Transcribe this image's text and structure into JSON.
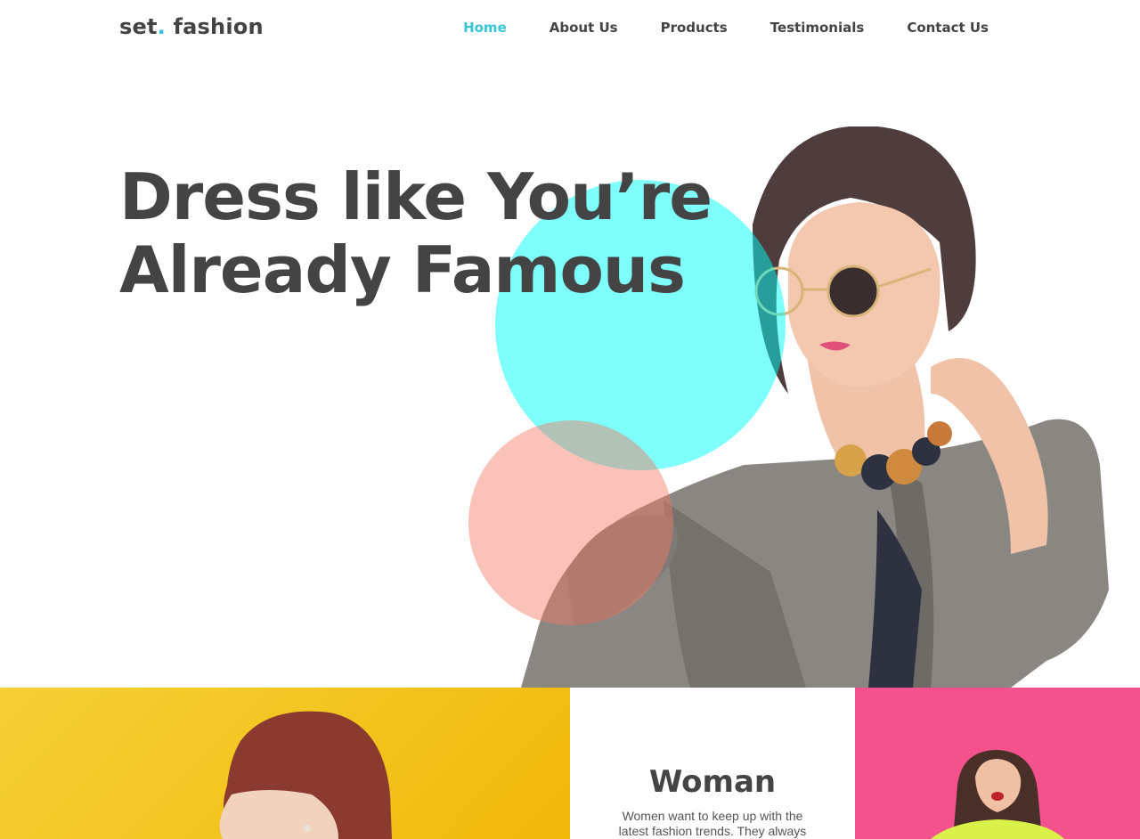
{
  "brand": {
    "name": "set",
    "dot": ".",
    "suffix": " fashion",
    "accent_color": "#38c5d8"
  },
  "nav": {
    "items": [
      {
        "label": "Home",
        "active": true
      },
      {
        "label": "About Us",
        "active": false
      },
      {
        "label": "Products",
        "active": false
      },
      {
        "label": "Testimonials",
        "active": false
      },
      {
        "label": "Contact Us",
        "active": false
      }
    ]
  },
  "hero": {
    "title_line1": "Dress like You’re",
    "title_line2": "Already Famous",
    "circle_colors": {
      "cyan": "#00fffa",
      "pink": "#f57864"
    }
  },
  "categories": {
    "woman": {
      "heading": "Woman",
      "text": "Women want to keep up with the latest fashion trends. They always"
    },
    "colors": {
      "yellow": "#f2c21a",
      "pink": "#f4528c"
    }
  }
}
